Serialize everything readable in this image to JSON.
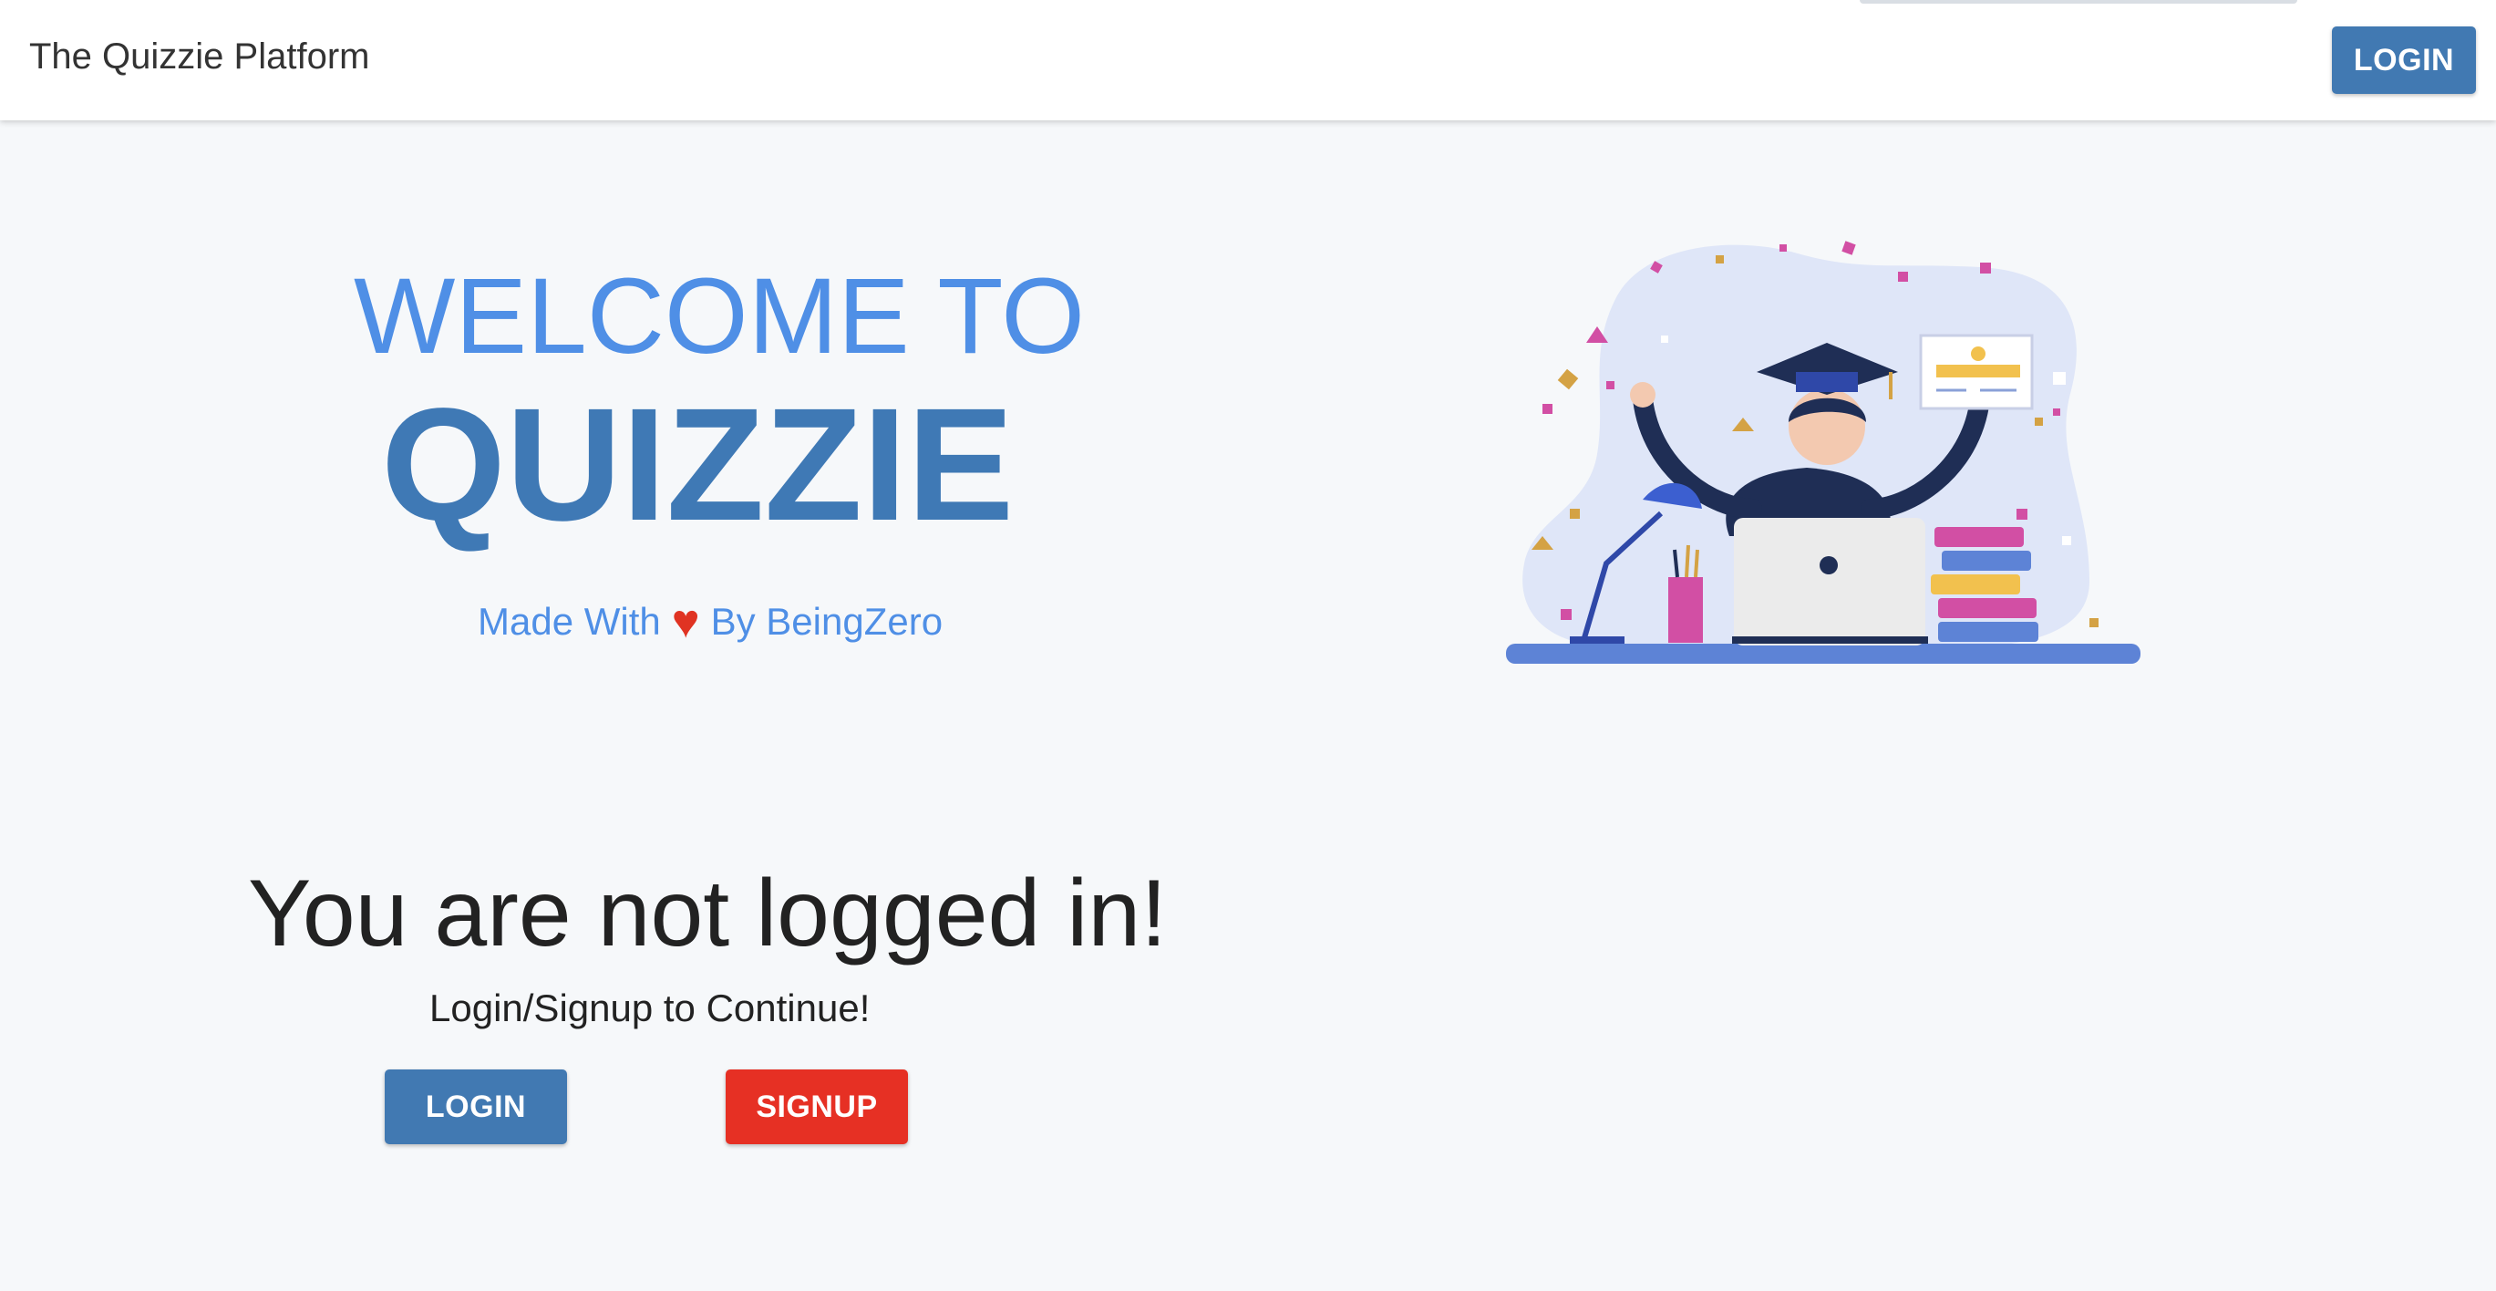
{
  "navbar": {
    "brand": "The Quizzie Platform",
    "login_label": "LOGIN"
  },
  "hero": {
    "welcome_line": "WELCOME TO",
    "title": "QUIZZIE",
    "made_with_prefix": "Made With",
    "heart_glyph": "♥",
    "made_with_suffix": "By BeingZero",
    "heart_color": "#e03322"
  },
  "auth": {
    "heading": "You are not logged in!",
    "subheading": "Login/Signup to Continue!",
    "login_label": "LOGIN",
    "signup_label": "SIGNUP"
  },
  "colors": {
    "primary": "#4179b2",
    "accent_blue": "#4f8fe6",
    "danger": "#e63024",
    "background": "#f6f8fa"
  },
  "illustration": {
    "icon": "graduate-illustration"
  }
}
